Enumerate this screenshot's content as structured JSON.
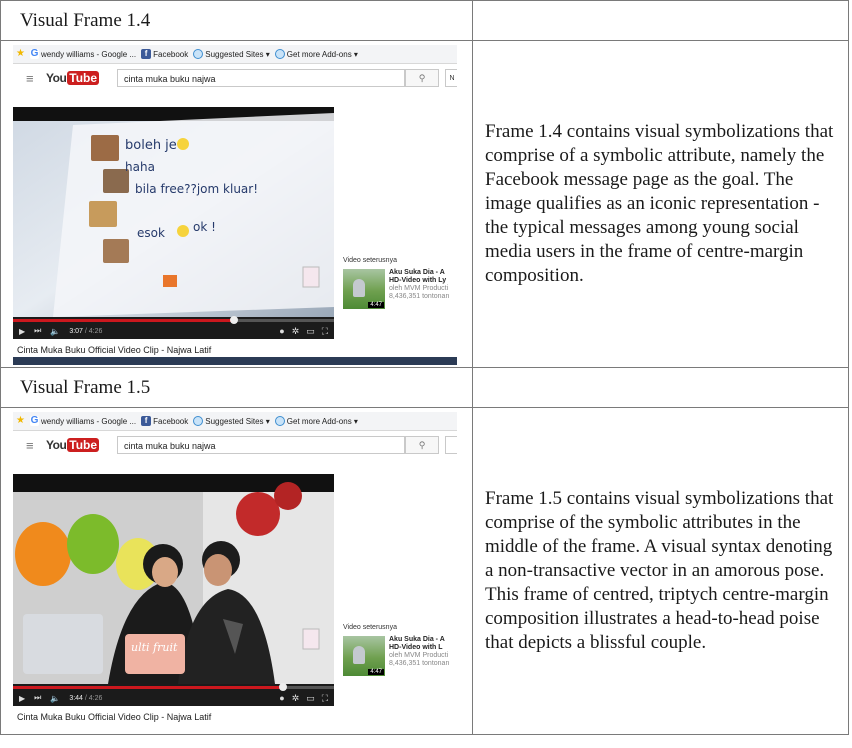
{
  "frames": [
    {
      "heading": "Visual Frame 1.4",
      "description": "Frame 1.4 contains visual symbolizations that comprise of a symbolic attribute, namely the Facebook message page as the goal. The image qualifies as an iconic representation - the typical messages among young social media users in the frame of centre-margin composition.",
      "screenshot": {
        "favorites": [
          "wendy williams - Google ...",
          "Facebook",
          "Suggested Sites ▾",
          "Get more Add-ons ▾"
        ],
        "logo_you": "You",
        "logo_tube": "Tube",
        "search_value": "cinta muka buku najwa",
        "video_lines": [
          "boleh je",
          "haha",
          "bila free??jom kluar!",
          "esok",
          "ok !"
        ],
        "time_current": "3:07",
        "time_total": "/ 4:26",
        "progress": 0.69,
        "next_heading": "Video seterusnya",
        "next_title_1": "Aku Suka Dia - A",
        "next_title_2": "HD-Video with Ly",
        "next_by": "oleh MVM Producti",
        "next_views": "8,436,351 tontonan",
        "next_duration": "4:47",
        "below_title": "Cinta Muka Buku Official Video Clip - Najwa Latif"
      }
    },
    {
      "heading": "Visual Frame 1.5",
      "description": "Frame 1.5 contains visual symbolizations that comprise of the symbolic attributes in the middle of the frame. A visual syntax denoting a non-transactive vector in an amorous pose. This frame of centred, triptych centre-margin composition illustrates a head-to-head poise that depicts a blissful couple.",
      "screenshot": {
        "favorites": [
          "wendy williams - Google ...",
          "Facebook",
          "Suggested Sites ▾",
          "Get more Add-ons ▾"
        ],
        "logo_you": "You",
        "logo_tube": "Tube",
        "search_value": "cinta muka buku najwa",
        "cup_text": "ulti fruit",
        "time_current": "3:44",
        "time_total": "/ 4:26",
        "progress": 0.84,
        "next_heading": "Video seterusnya",
        "next_title_1": "Aku Suka Dia - A",
        "next_title_2": "HD-Video with L",
        "next_by": "oleh MVM Producti",
        "next_views": "8,436,351 tontonan",
        "next_duration": "4:47",
        "below_title": "Cinta Muka Buku Official Video Clip - Najwa Latif"
      }
    }
  ]
}
